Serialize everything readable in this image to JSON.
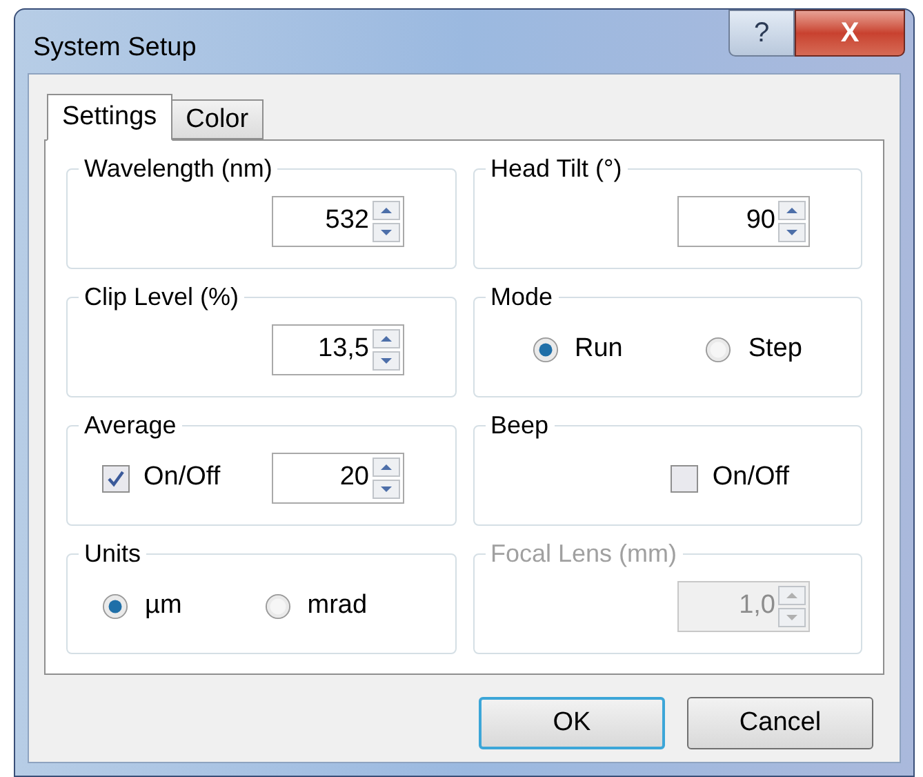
{
  "window": {
    "title": "System Setup",
    "help_button": "?",
    "close_button": "X"
  },
  "tabs": [
    {
      "label": "Settings",
      "selected": true
    },
    {
      "label": "Color",
      "selected": false
    }
  ],
  "groups": [
    {
      "title": "Wavelength (nm)",
      "disabled": false,
      "controls": [
        {
          "kind": "spin",
          "value": "532"
        }
      ]
    },
    {
      "title": "Head Tilt (°)",
      "disabled": false,
      "controls": [
        {
          "kind": "spin",
          "value": "90"
        }
      ]
    },
    {
      "title": "Clip Level (%)",
      "disabled": false,
      "controls": [
        {
          "kind": "spin",
          "value": "13,5"
        }
      ]
    },
    {
      "title": "Mode",
      "disabled": false,
      "controls": [
        {
          "kind": "radio",
          "label": "Run",
          "selected": true
        },
        {
          "kind": "radio",
          "label": "Step",
          "selected": false
        }
      ]
    },
    {
      "title": "Average",
      "disabled": false,
      "controls": [
        {
          "kind": "checkbox",
          "label": "On/Off",
          "checked": true
        },
        {
          "kind": "spin",
          "value": "20"
        }
      ]
    },
    {
      "title": "Beep",
      "disabled": false,
      "controls": [
        {
          "kind": "checkbox",
          "label": "On/Off",
          "checked": false
        }
      ]
    },
    {
      "title": "Units",
      "disabled": false,
      "controls": [
        {
          "kind": "radio",
          "label": "µm",
          "selected": true
        },
        {
          "kind": "radio",
          "label": "mrad",
          "selected": false
        }
      ]
    },
    {
      "title": "Focal Lens (mm)",
      "disabled": true,
      "controls": [
        {
          "kind": "spin",
          "value": "1,0"
        }
      ]
    }
  ],
  "buttons": [
    {
      "label": "OK",
      "default": true
    },
    {
      "label": "Cancel",
      "default": false
    }
  ]
}
